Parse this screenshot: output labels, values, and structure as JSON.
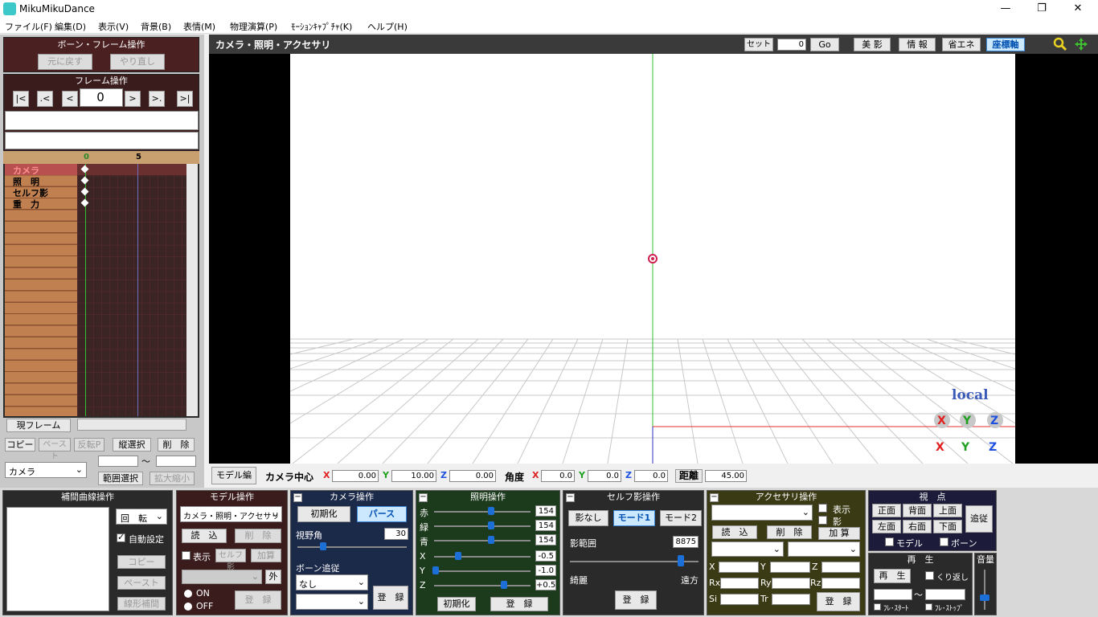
{
  "window": {
    "title": "MikuMikuDance",
    "minimize": "—",
    "restore": "❐",
    "close": "✕"
  },
  "menu": [
    "ファイル(F)",
    "編集(D)",
    "表示(V)",
    "背景(B)",
    "表情(M)",
    "物理演算(P)",
    "ﾓｰｼｮﾝｷｬﾌﾟﾁｬ(K)",
    "ヘルプ(H)"
  ],
  "bone_frame": {
    "title": "ボーン・フレーム操作",
    "undo": "元に戻す",
    "redo": "やり直し"
  },
  "frame_ops": {
    "title": "フレーム操作",
    "nav": [
      "|<",
      ".<",
      "<",
      ">",
      ">.",
      ">|"
    ],
    "frame_value": "0"
  },
  "timeline": {
    "tick0": "0",
    "tick5": "5",
    "tracks": [
      "カメラ",
      "照　明",
      "セルフ影",
      "重　力"
    ],
    "current_frame": "現フレーム",
    "copy": "コピー",
    "paste": "ペースト",
    "invert_paste": "反転P",
    "vertical_select": "縦選択",
    "delete": "削　除",
    "model_select": "カメラ",
    "range_select": "範囲選択",
    "scale": "拡大縮小",
    "tilde": "〜"
  },
  "viewport": {
    "title": "カメラ・照明・アクセサリ",
    "set": "セット",
    "set_value": "0",
    "go": "Go",
    "beauty": "美 影",
    "info": "情 報",
    "eco": "省エネ",
    "axis": "座標軸",
    "local": "local"
  },
  "camera_bar": {
    "model_edit": "モデル編",
    "center_label": "カメラ中心",
    "x": "0.00",
    "y": "10.00",
    "z": "0.00",
    "angle_label": "角度",
    "ax": "0.0",
    "ay": "0.0",
    "az": "0.0",
    "distance_label": "距離",
    "distance": "45.00",
    "X": "X",
    "Y": "Y",
    "Z": "Z"
  },
  "interp": {
    "title": "補間曲線操作",
    "rotate": "回　転",
    "auto": "自動設定",
    "copy": "コピー",
    "paste": "ペースト",
    "linear": "線形補間"
  },
  "model_ops": {
    "title": "モデル操作",
    "selected": "カメラ・照明・アクセサリ",
    "load": "読　込",
    "delete": "削　除",
    "show": "表示",
    "self_shadow": "セルフ影",
    "add": "加算",
    "outside": "外",
    "on": "ON",
    "off": "OFF",
    "register": "登　録"
  },
  "camera_ops": {
    "title": "カメラ操作",
    "init": "初期化",
    "perspective": "パース",
    "fov_label": "視野角",
    "fov": "30",
    "bone_follow": "ボーン追従",
    "follow_value": "なし",
    "register": "登　録"
  },
  "light_ops": {
    "title": "照明操作",
    "r_label": "赤",
    "g_label": "緑",
    "b_label": "青",
    "r": "154",
    "g": "154",
    "b": "154",
    "x_label": "X",
    "y_label": "Y",
    "z_label": "Z",
    "x": "-0.5",
    "y": "-1.0",
    "z": "+0.5",
    "init": "初期化",
    "register": "登　録"
  },
  "shadow_ops": {
    "title": "セルフ影操作",
    "none": "影なし",
    "mode1": "モード1",
    "mode2": "モード2",
    "range_label": "影範囲",
    "range": "8875",
    "near": "綺麗",
    "far": "遠方",
    "register": "登　録"
  },
  "accessory_ops": {
    "title": "アクセサリ操作",
    "show": "表示",
    "shadow": "影",
    "load": "読　込",
    "delete": "削　除",
    "add": "加 算",
    "x": "X",
    "y": "Y",
    "z": "Z",
    "rx": "Rx",
    "ry": "Ry",
    "rz": "Rz",
    "si": "Si",
    "tr": "Tr",
    "register": "登　録"
  },
  "view_ops": {
    "title": "視　点",
    "front": "正面",
    "back": "背面",
    "top": "上面",
    "left": "左面",
    "right": "右面",
    "bottom": "下面",
    "follow": "追従",
    "model": "モデル",
    "bone": "ボーン"
  },
  "play_ops": {
    "title": "再　生",
    "play": "再　生",
    "repeat": "くり返し",
    "tilde": "〜",
    "start": "ﾌﾚ･ｽﾀｰﾄ",
    "stop": "ﾌﾚ･ｽﾄｯﾌﾟ"
  },
  "volume": {
    "title": "音量"
  }
}
